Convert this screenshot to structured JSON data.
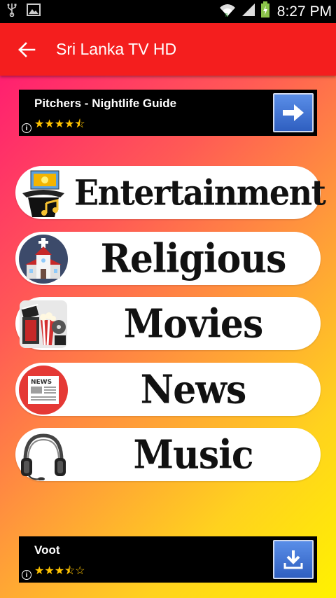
{
  "status_bar": {
    "time": "8:27 PM",
    "icons": [
      "usb-icon",
      "image-icon",
      "wifi-icon",
      "signal-icon",
      "battery-charging-icon"
    ]
  },
  "app_bar": {
    "title": "Sri Lanka TV HD",
    "back_icon": "back-arrow-icon"
  },
  "ads": {
    "top": {
      "title": "Pitchers - Nightlife Guide",
      "rating_stars": "★★★★⯪",
      "rating": 4.5,
      "action_icon": "arrow-right-icon"
    },
    "bottom": {
      "title": "Voot",
      "rating_stars": "★★★⯪☆",
      "rating": 3.5,
      "action_icon": "download-icon"
    }
  },
  "categories": [
    {
      "label": "Entertainment",
      "icon": "entertainment-icon"
    },
    {
      "label": "Religious",
      "icon": "church-icon"
    },
    {
      "label": "Movies",
      "icon": "movie-icon"
    },
    {
      "label": "News",
      "icon": "newspaper-icon"
    },
    {
      "label": "Music",
      "icon": "headphones-icon"
    }
  ],
  "colors": {
    "app_bar": "#f41e1e",
    "gradient_start": "#ff1f70",
    "gradient_end": "#fff200",
    "star": "#ffc300"
  }
}
